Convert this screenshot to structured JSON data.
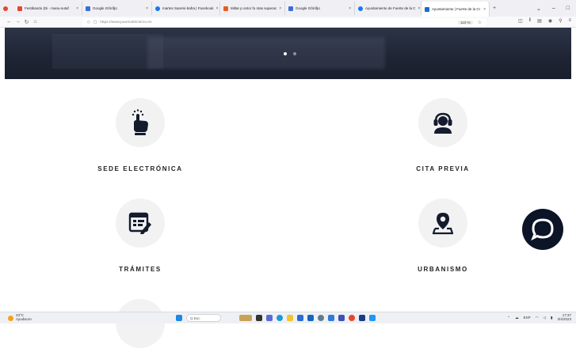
{
  "browser": {
    "tabs": [
      {
        "title": "Festibando (Di - manu-sutaf",
        "color": "#e8452c"
      },
      {
        "title": "Google Gõrrðjü",
        "color": "#3b6fd8"
      },
      {
        "title": "martes Saremi-bafra | Facebook",
        "color": "#1877f2"
      },
      {
        "title": "Miltar p ontor fo ntas superac",
        "color": "#e85b20"
      },
      {
        "title": "Google Gõrrðjü",
        "color": "#3b6fd8"
      },
      {
        "title": "Ayuntamiento de Fuerte de la C",
        "color": "#1877f2"
      },
      {
        "title": "Ayuntamiento | Fuerte de la Cr",
        "color": "#1e6ac8",
        "active": true
      }
    ],
    "url": "https://www.puertodelcierzo.es",
    "zoom": "110 %"
  },
  "hero": {
    "slides_total": 2,
    "active_slide": 1
  },
  "services": [
    {
      "label": "SEDE ELECTRÓNICA",
      "icon": "touch-hand-icon"
    },
    {
      "label": "CITA PREVIA",
      "icon": "headset-agent-icon"
    },
    {
      "label": "TRÁMITES",
      "icon": "form-edit-icon"
    },
    {
      "label": "URBANISMO",
      "icon": "map-pin-icon"
    }
  ],
  "chat_button": {
    "icon": "chat-bubble-icon"
  },
  "taskbar": {
    "weather_temp": "23°C",
    "weather_text": "Ayudacon",
    "search_placeholder": "Q  Buc",
    "language": "ESP",
    "time": "17:37",
    "date": "3/4/2023"
  }
}
